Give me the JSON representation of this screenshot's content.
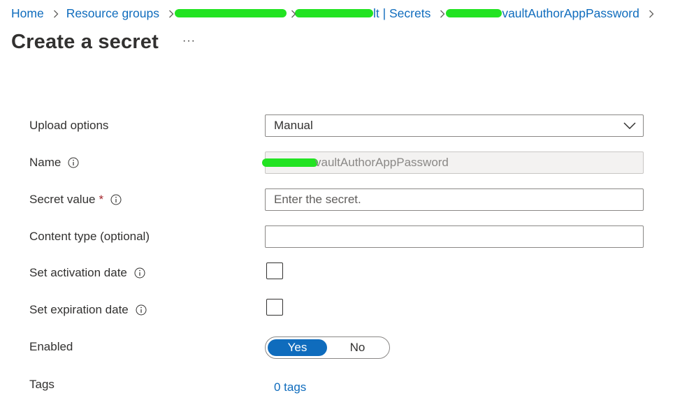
{
  "breadcrumb": {
    "home": "Home",
    "resource_groups": "Resource groups",
    "secrets_partial": "lt | Secrets",
    "secret_partial": "vaultAuthorAppPassword"
  },
  "page": {
    "title": "Create a secret",
    "more": "···"
  },
  "form": {
    "upload_options": {
      "label": "Upload options",
      "value": "Manual"
    },
    "name": {
      "label": "Name",
      "value": "vaultAuthorAppPassword"
    },
    "secret_value": {
      "label": "Secret value",
      "required_mark": "*",
      "placeholder": "Enter the secret."
    },
    "content_type": {
      "label": "Content type (optional)",
      "value": ""
    },
    "activation_date": {
      "label": "Set activation date",
      "checked": false
    },
    "expiration_date": {
      "label": "Set expiration date",
      "checked": false
    },
    "enabled": {
      "label": "Enabled",
      "yes": "Yes",
      "no": "No",
      "selected": "Yes"
    },
    "tags": {
      "label": "Tags",
      "link": "0 tags"
    }
  },
  "colors": {
    "link": "#0f6cbd",
    "toggle_selected": "#0f6cbd",
    "required": "#a4262c",
    "redaction": "#22e322"
  },
  "icons": {
    "breadcrumb_separator": "chevron-right-icon",
    "dropdown": "chevron-down-icon",
    "info": "info-icon",
    "more": "more-icon"
  }
}
